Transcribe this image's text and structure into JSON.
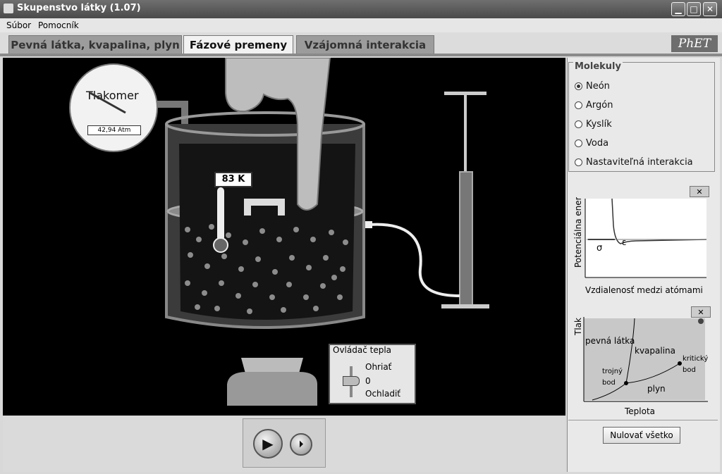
{
  "window": {
    "title": "Skupenstvo látky (1.07)",
    "minimize": "▁",
    "maximize": "□",
    "close": "✕"
  },
  "menu": {
    "file": "Súbor",
    "help": "Pomocník"
  },
  "tabs": [
    {
      "label": "Pevná látka, kvapalina, plyn"
    },
    {
      "label": "Fázové premeny"
    },
    {
      "label": "Vzájomná interakcia"
    }
  ],
  "logo": "PhET",
  "gauge": {
    "label": "Tlakomer",
    "value": "42,94 Atm"
  },
  "thermometer": {
    "value": "83 K"
  },
  "heat_control": {
    "title": "Ovládač tepla",
    "heat": "Ohriať",
    "zero": "0",
    "cool": "Ochladiť"
  },
  "molecules": {
    "title": "Molekuly",
    "options": [
      "Neón",
      "Argón",
      "Kyslík",
      "Voda",
      "Nastaviteľná interakcia"
    ],
    "selected": "Neón"
  },
  "potential_chart": {
    "ylabel": "Potenciálna energia",
    "xlabel": "Vzdialenosť medzi atómami",
    "sigma": "σ",
    "epsilon": "ε",
    "close": "✕"
  },
  "phase_chart": {
    "ylabel": "Tlak",
    "xlabel": "Teplota",
    "solid": "pevná látka",
    "liquid": "kvapalina",
    "gas": "plyn",
    "triple1": "trojný",
    "triple2": "bod",
    "critical1": "kritický",
    "critical2": "bod",
    "close": "✕"
  },
  "reset_label": "Nulovať všetko",
  "playback": {
    "play": "▶",
    "step": "⏵"
  },
  "colors": {
    "sim_bg": "#000000",
    "panel_bg": "#e9e9e9",
    "phase_bg": "#c8c8c8"
  }
}
